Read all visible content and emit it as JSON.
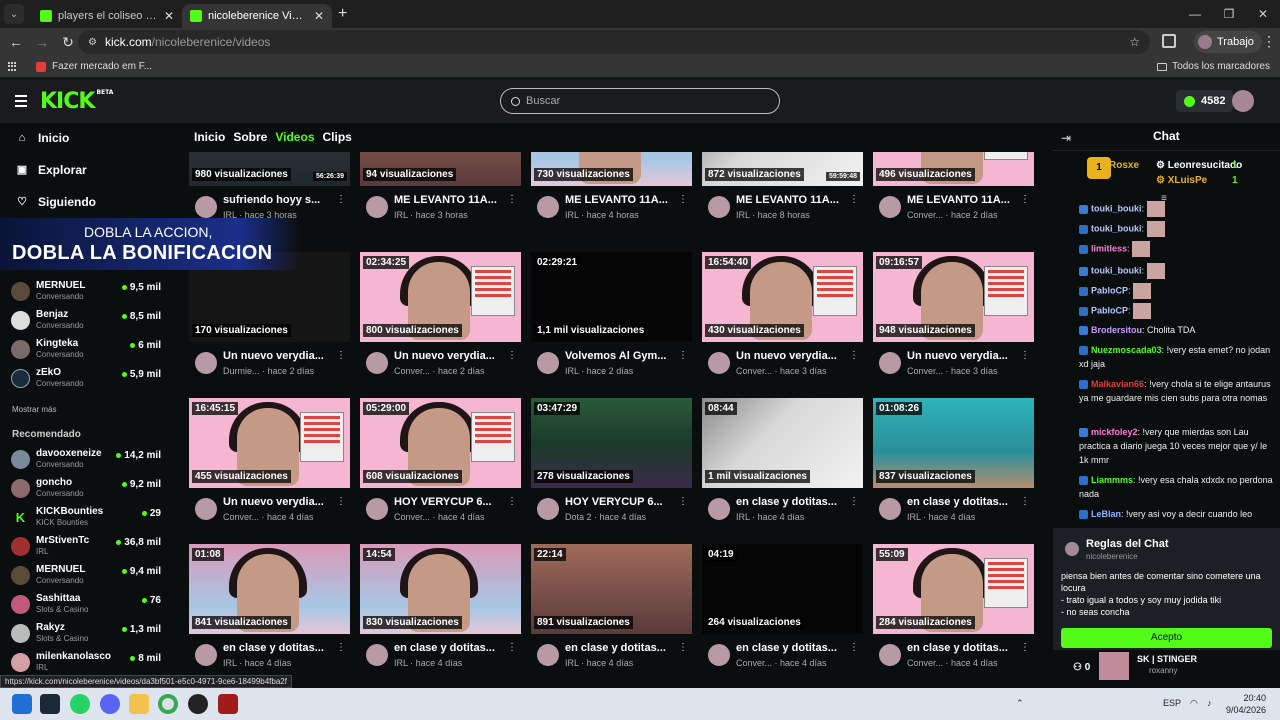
{
  "browser": {
    "tabs": [
      {
        "title": "players el coliseo de benjaz - H"
      },
      {
        "title": "nicoleberenice Videos - Watch"
      }
    ],
    "url_host": "kick.com",
    "url_path": "/nicoleberenice/videos",
    "profile": "Trabajo",
    "bookmark": "Fazer mercado em F...",
    "bookmarks_right": "Todos los marcadores",
    "status_url": "https://kick.com/nicoleberenice/videos/da3bf501-e5c0-4971-9ce6-18499b4fba2f"
  },
  "header": {
    "logo": "KICK",
    "logo_badge": "BETA",
    "search_placeholder": "Buscar",
    "points": "4582"
  },
  "sidebar": {
    "nav": [
      {
        "label": "Inicio",
        "icon": "home-icon"
      },
      {
        "label": "Explorar",
        "icon": "compass-icon"
      },
      {
        "label": "Siguiendo",
        "icon": "heart-icon"
      }
    ],
    "promo_line1": "DOBLA LA ACCION,",
    "promo_line2": "DOBLA LA BONIFICACION",
    "partial_cat": "IRL",
    "following": [
      {
        "name": "MERNUEL",
        "cat": "Conversando",
        "viewers": "9,5 mil"
      },
      {
        "name": "Benjaz",
        "cat": "Conversando",
        "viewers": "8,5 mil"
      },
      {
        "name": "Kingteka",
        "cat": "Conversando",
        "viewers": "6 mil"
      },
      {
        "name": "zEkO",
        "cat": "Conversando",
        "viewers": "5,9 mil"
      }
    ],
    "show_more": "Mostrar más",
    "recommended_title": "Recomendado",
    "recommended": [
      {
        "name": "davooxeneize",
        "cat": "Conversando",
        "viewers": "14,2 mil"
      },
      {
        "name": "goncho",
        "cat": "Conversando",
        "viewers": "9,2 mil"
      },
      {
        "name": "KICKBounties",
        "cat": "KICK Bounties",
        "viewers": "29"
      },
      {
        "name": "MrStivenTc",
        "cat": "IRL",
        "viewers": "36,8 mil"
      },
      {
        "name": "MERNUEL",
        "cat": "Conversando",
        "viewers": "9,4 mil"
      },
      {
        "name": "Sashittaa",
        "cat": "Slots & Casino",
        "viewers": "76"
      },
      {
        "name": "Rakyz",
        "cat": "Slots & Casino",
        "viewers": "1,3 mil"
      },
      {
        "name": "milenkanolasco",
        "cat": "IRL",
        "viewers": "8 mil"
      }
    ]
  },
  "channel_tabs": [
    "Inicio",
    "Sobre",
    "Videos",
    "Clips"
  ],
  "videos": [
    [
      {
        "dur": "",
        "dur2": "56:26:39",
        "views": "980 visualizaciones",
        "title": "sufriendo hoyy s...",
        "meta": "IRL · hace 3 horas",
        "bg": "bg-street"
      },
      {
        "dur": "",
        "dur2": "",
        "views": "94 visualizaciones",
        "title": "ME LEVANTO 11A...",
        "meta": "IRL · hace 3 horas",
        "bg": "bg-warm"
      },
      {
        "dur": "",
        "dur2": "",
        "views": "730 visualizaciones",
        "title": "ME LEVANTO 11A...",
        "meta": "IRL · hace 4 horas",
        "bg": "bg-pinkroom"
      },
      {
        "dur": "",
        "dur2": "59:59:48",
        "views": "872 visualizaciones",
        "title": "ME LEVANTO 11A...",
        "meta": "IRL · hace 8 horas",
        "bg": "bg-room"
      },
      {
        "dur": "",
        "dur2": "",
        "views": "496 visualizaciones",
        "title": "ME LEVANTO 11A...",
        "meta": "Conver... · hace 2 días",
        "bg": "bg-pink"
      }
    ],
    [
      {
        "dur": "",
        "dur2": "",
        "views": "170 visualizaciones",
        "title": "Un nuevo verydia...",
        "meta": "Durmie... · hace 2 días",
        "bg": "bg-dark"
      },
      {
        "dur": "02:34:25",
        "dur2": "",
        "views": "800 visualizaciones",
        "title": "Un nuevo verydia...",
        "meta": "Conver... · hace 2 días",
        "bg": "bg-pink"
      },
      {
        "dur": "02:29:21",
        "dur2": "",
        "views": "1,1 mil visualizaciones",
        "title": "Volvemos Al Gym...",
        "meta": "IRL · hace 2 días",
        "bg": "bg-black"
      },
      {
        "dur": "16:54:40",
        "dur2": "",
        "views": "430 visualizaciones",
        "title": "Un nuevo verydia...",
        "meta": "Conver... · hace 3 días",
        "bg": "bg-pink"
      },
      {
        "dur": "09:16:57",
        "dur2": "",
        "views": "948 visualizaciones",
        "title": "Un nuevo verydia...",
        "meta": "Conver... · hace 3 días",
        "bg": "bg-pink"
      }
    ],
    [
      {
        "dur": "16:45:15",
        "dur2": "",
        "views": "455 visualizaciones",
        "title": "Un nuevo verydia...",
        "meta": "Conver... · hace 4 días",
        "bg": "bg-pink"
      },
      {
        "dur": "05:29:00",
        "dur2": "",
        "views": "608 visualizaciones",
        "title": "HOY VERYCUP 6...",
        "meta": "Conver... · hace 4 días",
        "bg": "bg-pink"
      },
      {
        "dur": "03:47:29",
        "dur2": "",
        "views": "278 visualizaciones",
        "title": "HOY VERYCUP 6...",
        "meta": "Dota 2 · hace 4 días",
        "bg": "bg-game"
      },
      {
        "dur": "08:44",
        "dur2": "",
        "views": "1 mil visualizaciones",
        "title": "en clase y dotitas...",
        "meta": "IRL · hace 4 días",
        "bg": "bg-room"
      },
      {
        "dur": "01:08:26",
        "dur2": "",
        "views": "837 visualizaciones",
        "title": "en clase y dotitas...",
        "meta": "IRL · hace 4 días",
        "bg": "bg-teal"
      }
    ],
    [
      {
        "dur": "01:08",
        "dur2": "",
        "views": "841 visualizaciones",
        "title": "en clase y dotitas...",
        "meta": "IRL · hace 4 días",
        "bg": "bg-pinkroom"
      },
      {
        "dur": "14:54",
        "dur2": "",
        "views": "830 visualizaciones",
        "title": "en clase y dotitas...",
        "meta": "IRL · hace 4 días",
        "bg": "bg-pinkroom"
      },
      {
        "dur": "22:14",
        "dur2": "",
        "views": "891 visualizaciones",
        "title": "en clase y dotitas...",
        "meta": "IRL · hace 4 días",
        "bg": "bg-warm"
      },
      {
        "dur": "04:19",
        "dur2": "",
        "views": "264 visualizaciones",
        "title": "en clase y dotitas...",
        "meta": "Conver... · hace 4 días",
        "bg": "bg-black"
      },
      {
        "dur": "55:09",
        "dur2": "",
        "views": "284 visualizaciones",
        "title": "en clase y dotitas...",
        "meta": "Conver... · hace 4 días",
        "bg": "bg-pink"
      }
    ]
  ],
  "chat": {
    "title": "Chat",
    "gifters": [
      {
        "name": "Rosxe",
        "count": "1"
      },
      {
        "name": "Leonresucitado",
        "count": "1"
      },
      {
        "name": "XLuisPe",
        "count": "1"
      }
    ],
    "messages": [
      {
        "user": "touki_bouki",
        "text": "",
        "color": "#b8c7ff"
      },
      {
        "user": "touki_bouki",
        "text": "",
        "color": "#b8c7ff"
      },
      {
        "user": "limitless",
        "text": "",
        "color": "#ff7ad9"
      },
      {
        "user": "touki_bouki",
        "text": "",
        "color": "#b8c7ff"
      },
      {
        "user": "PabloCP",
        "text": "",
        "color": "#b8c7ff"
      },
      {
        "user": "PabloCP",
        "text": "",
        "color": "#b8c7ff"
      },
      {
        "user": "Brodersitou",
        "text": "Cholita TDA",
        "color": "#c59cff"
      },
      {
        "user": "Nuezmoscada03",
        "text": "!very esta emet? no jodan xd jaja",
        "color": "#53fc18"
      },
      {
        "user": "Malkavian66",
        "text": "!very chola si te elige antaurus ya me guardare mis cien subs para otra nomas",
        "color": "#e03a3a"
      },
      {
        "user": "mickfoley2",
        "text": "!very que mierdas son Lau practica a diario juega 10 veces mejor que y/ le 1k mmr",
        "color": "#ff7ad9"
      },
      {
        "user": "Liammms",
        "text": "!very esa chala xdxdx no perdona nada",
        "color": "#53fc18"
      },
      {
        "user": "LeBlan",
        "text": "!very asi voy a decir cuando leo",
        "color": "#8fb5ff"
      }
    ],
    "rules_title": "Reglas del Chat",
    "rules_channel": "nicoleberenice",
    "rules_text": [
      "piensa bien antes de comentar sino cometere una locura",
      "- trato igual a todos y soy muy jodida tiki",
      "- no seas concha"
    ],
    "accept": "Acepto",
    "viewer_count": "0",
    "bottom_name": "SK | STINGER",
    "bottom_user": "roxanny"
  },
  "taskbar": {
    "lang": "ESP",
    "time": "20:40",
    "date": "9/04/2026"
  }
}
